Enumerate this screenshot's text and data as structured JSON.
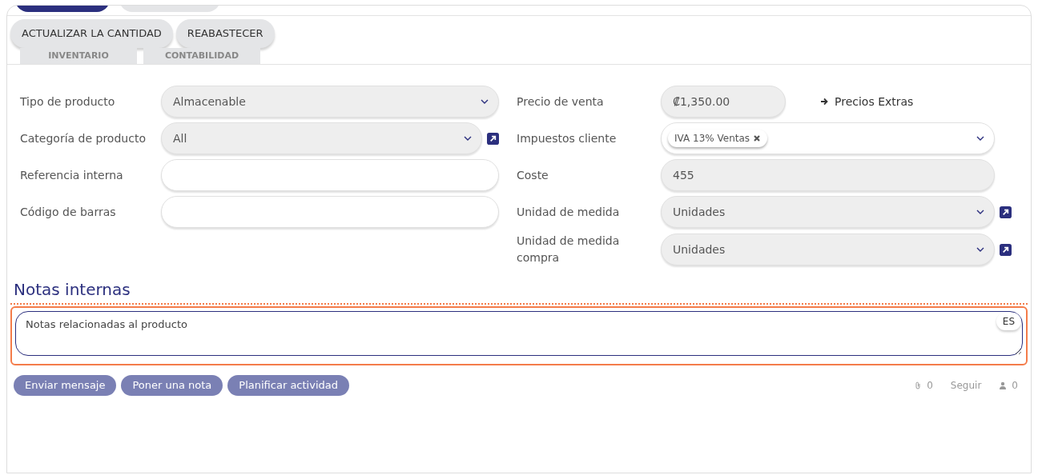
{
  "actions": [
    "ACTUALIZAR LA CANTIDAD",
    "REABASTECER"
  ],
  "tabs": [
    {
      "label": "INVENTARIO",
      "selected": false
    },
    {
      "label": "CONTABILIDAD",
      "selected": false
    }
  ],
  "left_fields": [
    {
      "label": "Tipo de producto",
      "kind": "select",
      "value": "Almacenable",
      "shaded": true,
      "link": false
    },
    {
      "label": "Categoría de producto",
      "kind": "select",
      "value": "All",
      "shaded": true,
      "link": true
    },
    {
      "label": "Referencia interna",
      "kind": "input",
      "shaded": false,
      "link": false
    },
    {
      "label": "Código de barras",
      "kind": "input",
      "shaded": false,
      "link": false
    }
  ],
  "right_fields": [
    {
      "label": "Precio de venta",
      "kind": "price",
      "value": "₡1,350.00",
      "shaded": true,
      "link": false,
      "extra": "Precios Extras"
    },
    {
      "label": "Impuestos cliente",
      "kind": "tags",
      "tags": [
        "IVA 13% Ventas"
      ],
      "shaded": false,
      "link": false
    },
    {
      "label": "Coste",
      "kind": "input",
      "value": "455",
      "shaded": true,
      "link": false
    },
    {
      "label": "Unidad de medida",
      "kind": "select",
      "value": "Unidades",
      "shaded": true,
      "link": true
    },
    {
      "label": "Unidad de medida compra",
      "kind": "select",
      "value": "Unidades",
      "shaded": true,
      "link": true
    }
  ],
  "notes": {
    "heading": "Notas internas",
    "placeholder": "Notas relacionadas al producto",
    "lang": "ES",
    "highlighted": true
  },
  "chatter": {
    "buttons": [
      "Enviar mensaje",
      "Poner una nota",
      "Planificar actividad"
    ],
    "attachments": "0",
    "follow": "Seguir",
    "followers": "0"
  }
}
